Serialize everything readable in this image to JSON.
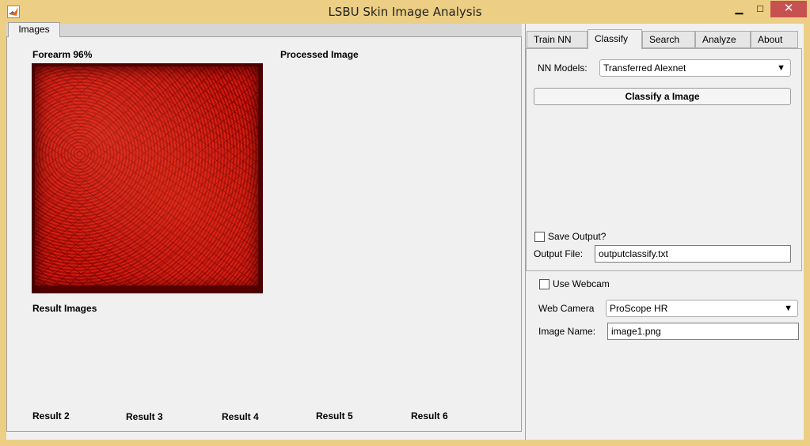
{
  "window": {
    "title": "LSBU Skin Image Analysis",
    "min_glyph": "▁",
    "max_glyph": "□",
    "close_glyph": "✕",
    "accent_color": "#eccf84",
    "close_color": "#c75050"
  },
  "left_panel": {
    "tab_label": "Images",
    "original_image_label": "Forearm 96%",
    "processed_image_label": "Processed Image",
    "result_images_label": "Result Images",
    "results": [
      "Result 2",
      "Result 3",
      "Result 4",
      "Result 5",
      "Result 6"
    ]
  },
  "right_panel": {
    "tabs": [
      "Train NN",
      "Classify",
      "Search",
      "Analyze",
      "About"
    ],
    "active_tab": "Classify",
    "classify": {
      "nn_models_label": "NN Models:",
      "nn_models_value": "Transferred Alexnet",
      "classify_button": "Classify a Image",
      "save_output_label": "Save Output?",
      "save_output_checked": false,
      "output_file_label": "Output File:",
      "output_file_value": "outputclassify.txt"
    },
    "webcam": {
      "use_webcam_label": "Use Webcam",
      "use_webcam_checked": false,
      "web_camera_label": "Web Camera",
      "web_camera_value": "ProScope HR",
      "image_name_label": "Image Name:",
      "image_name_value": "image1.png"
    },
    "dropdown_arrow": "▼"
  }
}
